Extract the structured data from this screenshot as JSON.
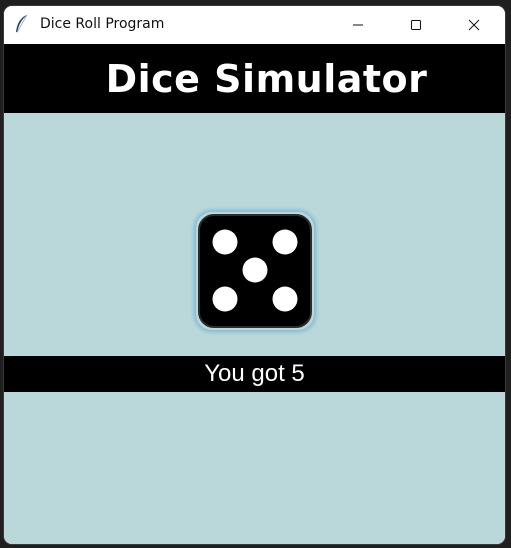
{
  "window": {
    "title": "Dice Roll Program",
    "icon": "feather-icon",
    "controls": [
      "minimize-icon",
      "maximize-icon",
      "close-icon"
    ]
  },
  "header": {
    "title": "Dice Simulator"
  },
  "die": {
    "value": 5,
    "face_color": "#000000",
    "pip_color": "#ffffff"
  },
  "result": {
    "text": "You got 5"
  },
  "colors": {
    "background": "#bad8d9",
    "header_bg": "#000000",
    "text": "#ffffff",
    "die_glow": "#7fb6d6"
  }
}
